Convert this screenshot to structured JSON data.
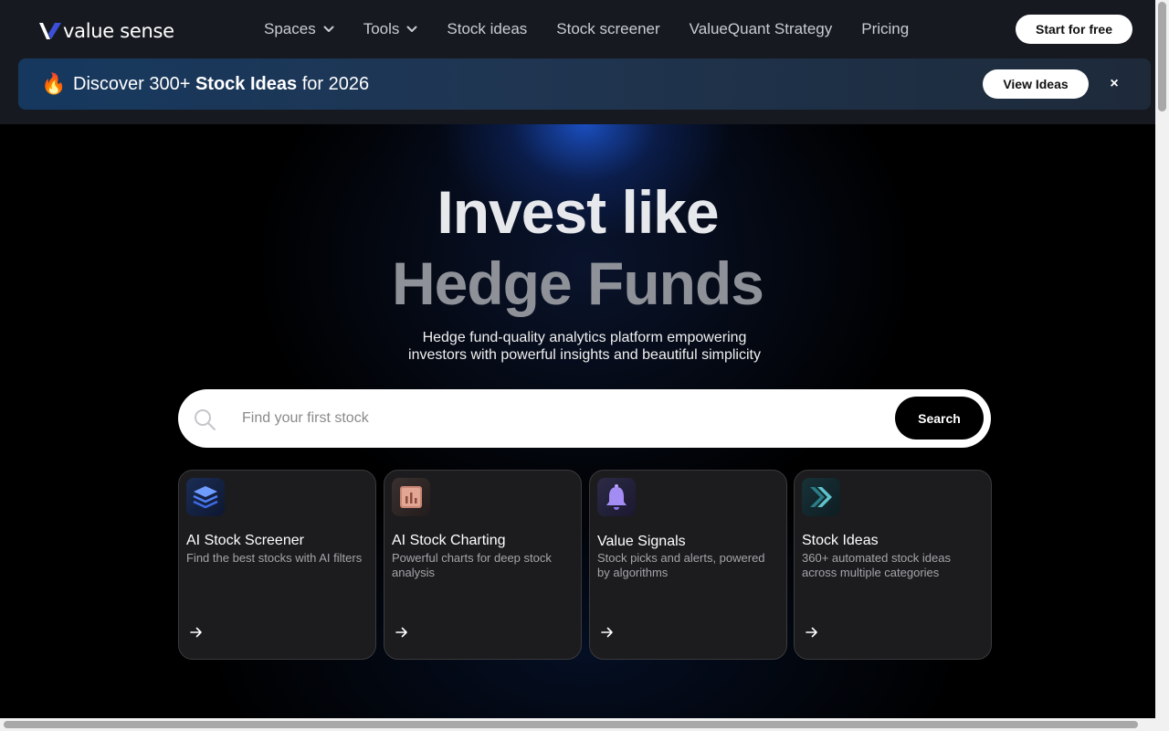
{
  "header": {
    "logo_text": "value sense",
    "nav": [
      {
        "label": "Spaces",
        "has_dropdown": true
      },
      {
        "label": "Tools",
        "has_dropdown": true
      },
      {
        "label": "Stock ideas",
        "has_dropdown": false
      },
      {
        "label": "Stock screener",
        "has_dropdown": false
      },
      {
        "label": "ValueQuant Strategy",
        "has_dropdown": false
      },
      {
        "label": "Pricing",
        "has_dropdown": false
      }
    ],
    "cta_label": "Start for free"
  },
  "banner": {
    "emoji": "🔥",
    "text_prefix": "Discover 300+ ",
    "text_bold": "Stock Ideas",
    "text_suffix": " for 2026",
    "button_label": "View Ideas",
    "close_label": "×"
  },
  "hero": {
    "headline_line1": "Invest like",
    "headline_line2": "Hedge Funds",
    "subtitle_line1": "Hedge fund-quality analytics platform empowering",
    "subtitle_line2": "investors with powerful insights and beautiful simplicity"
  },
  "search": {
    "placeholder": "Find your first stock",
    "value": "",
    "button_label": "Search"
  },
  "cards": [
    {
      "title": "AI Stock Screener",
      "description": "Find the best stocks with AI filters",
      "icon": "layers-icon"
    },
    {
      "title": "AI Stock Charting",
      "description": "Powerful charts for deep stock analysis",
      "icon": "bar-chart-icon"
    },
    {
      "title": "Value Signals",
      "description": "Stock picks and alerts, powered by algorithms",
      "icon": "bell-icon"
    },
    {
      "title": "Stock Ideas",
      "description": "360+ automated stock ideas across multiple categories",
      "icon": "double-chevron-icon"
    }
  ],
  "colors": {
    "page_bg": "#000000",
    "header_bg": "#161a20",
    "banner_start": "#16385f",
    "glow": "#1e5adc",
    "card_bg": "#1c1c1e"
  }
}
